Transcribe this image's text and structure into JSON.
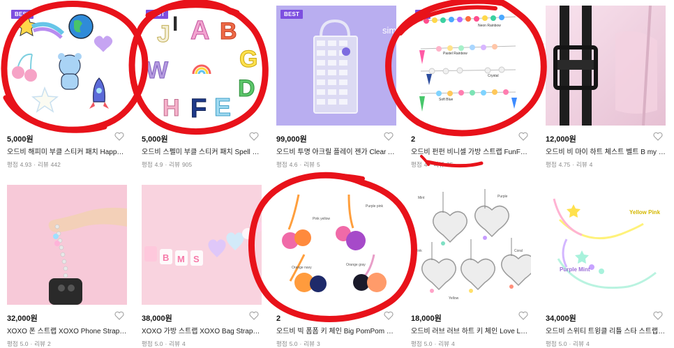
{
  "products": [
    {
      "badge": "BEST",
      "price": "5,000원",
      "title": "오드비 해피미 부클 스티커 패치 Happy ...",
      "rating_label": "평점",
      "rating": "4.93",
      "review_label": "리뷰",
      "reviews": "442",
      "thumb_bg": "#ffffff"
    },
    {
      "badge": "BEST",
      "price": "5,000원",
      "title": "오드비 스펠미 부클 스티커 패치 Spell M...",
      "rating_label": "평점",
      "rating": "4.9",
      "review_label": "리뷰",
      "reviews": "905",
      "thumb_bg": "#ffffff"
    },
    {
      "badge": "BEST",
      "price": "99,000원",
      "title": "오드비 투명 아크릴 플레이 젠가 Clear A...",
      "rating_label": "평점",
      "rating": "4.6",
      "review_label": "리뷰",
      "reviews": "5",
      "thumb_bg": "#b9aef0",
      "thumb_text": "simple"
    },
    {
      "badge": "BE",
      "price": "2",
      "title": "오드비 펀펀 비니셀 가방 스트랩 FunFun...",
      "rating_label": "평점",
      "rating": "4",
      "review_label": "리뷰",
      "reviews": "25",
      "thumb_bg": "#ffffff",
      "strap_labels": [
        "Neon Rainbow",
        "Pastel Rainbow",
        "Crystal",
        "Soft Blue"
      ]
    },
    {
      "badge": "",
      "price": "12,000원",
      "title": "오드비 비 마이 하트 체스트 벨트 B my H...",
      "rating_label": "평점",
      "rating": "4.75",
      "review_label": "리뷰",
      "reviews": "4",
      "thumb_bg": "#f2dbe6"
    },
    {
      "badge": "",
      "price": "32,000원",
      "title": "XOXO 폰 스트랩 XOXO Phone Strap ...",
      "rating_label": "평점",
      "rating": "5.0",
      "review_label": "리뷰",
      "reviews": "2",
      "thumb_bg": "#f7c9d8"
    },
    {
      "badge": "",
      "price": "38,000원",
      "title": "XOXO 가방 스트랩 XOXO Bag Strap o...",
      "rating_label": "평점",
      "rating": "5.0",
      "review_label": "리뷰",
      "reviews": "4",
      "thumb_bg": "#f9d3df"
    },
    {
      "badge": "",
      "price": "2",
      "title": "오드비 빅 폼폼 키 체인 Big PomPom K...",
      "rating_label": "평점",
      "rating": "5.0",
      "review_label": "리뷰",
      "reviews": "3",
      "thumb_bg": "#ffffff",
      "pompom_labels": [
        "Pink yellow",
        "Purple pink",
        "Orange navy",
        "Orange gray"
      ]
    },
    {
      "badge": "",
      "price": "18,000원",
      "title": "오드비 러브 러브 하트 키 체인 Love Lov...",
      "rating_label": "평점",
      "rating": "5.0",
      "review_label": "리뷰",
      "reviews": "4",
      "thumb_bg": "#ffffff",
      "keychain_labels": [
        "Mint",
        "Purple",
        "Pink",
        "Coral",
        "Yellow"
      ]
    },
    {
      "badge": "",
      "price": "34,000원",
      "title": "오드비 스위티 트윙클 리틀 스타 스트랩 ...",
      "rating_label": "평점",
      "rating": "5.0",
      "review_label": "리뷰",
      "reviews": "4",
      "thumb_bg": "#ffffff",
      "twinkle_labels": [
        "Yellow Pink",
        "Purple Mint"
      ]
    }
  ],
  "colors": {
    "badge": "#7d4fe0",
    "annotation": "#e8121a",
    "heart": "#9a9a9a"
  }
}
